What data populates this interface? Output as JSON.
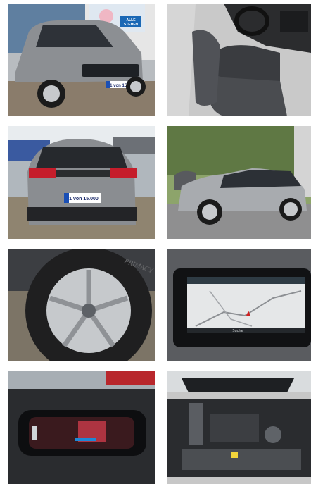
{
  "gallery": {
    "photos": [
      {
        "name": "front-three-quarter",
        "plate": "1 von 15.000",
        "sign": "ALLE\nSTEHEN"
      },
      {
        "name": "interior-driver-seat"
      },
      {
        "name": "rear-view",
        "plate": "1 von 15.000"
      },
      {
        "name": "side-profile"
      },
      {
        "name": "wheel-detail",
        "tyre_text": "PRIMACY"
      },
      {
        "name": "navigation-screen",
        "screen_label": "Suche"
      },
      {
        "name": "digital-instrument-cluster"
      },
      {
        "name": "engine-bay"
      }
    ]
  }
}
